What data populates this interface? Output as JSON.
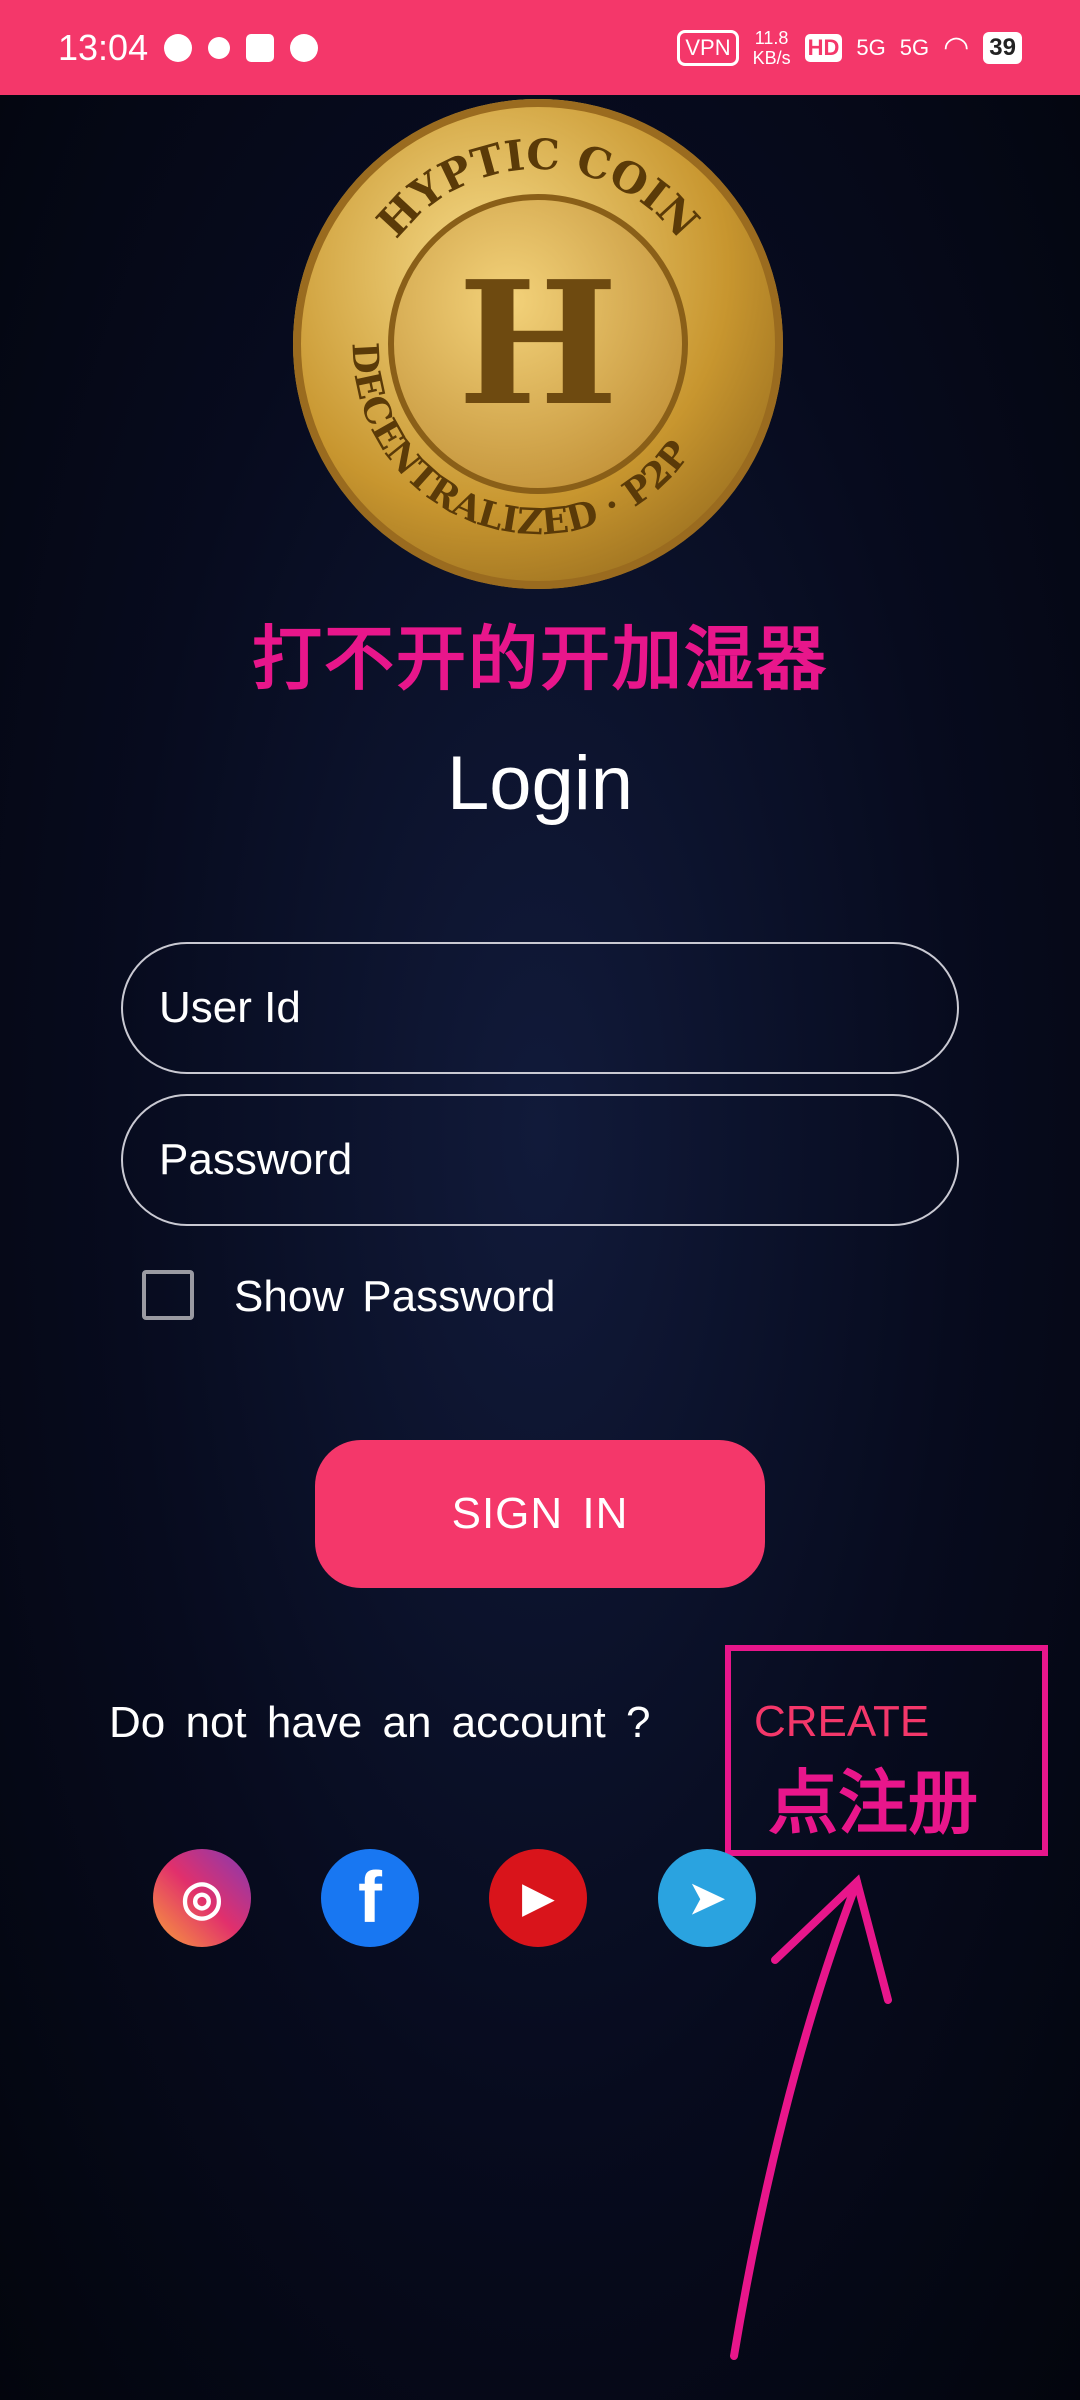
{
  "status_bar": {
    "time": "13:04",
    "vpn": "VPN",
    "speed": "11.8",
    "speed_unit": "KB/s",
    "hd": "HD",
    "net1": "5G",
    "net2": "5G",
    "battery": "39",
    "color": "#f4376a"
  },
  "logo": {
    "text": "HYPTIC COIN",
    "sub_left": "DECENTRALIZED",
    "sub_right": "P2P",
    "mark": "H"
  },
  "annotation_title": "打不开的开加湿器",
  "login": {
    "title": "Login",
    "user_placeholder": "User Id",
    "password_placeholder": "Password",
    "show_password": "Show Password",
    "show_password_checked": false,
    "sign_in": "SIGN IN",
    "no_account": "Do not have an account ?",
    "create": "CREATE"
  },
  "annotation_register": "点注册",
  "social": [
    "instagram-icon",
    "facebook-icon",
    "youtube-icon",
    "telegram-icon"
  ],
  "colors": {
    "accent": "#f4376a",
    "annotation": "#e8168b"
  }
}
